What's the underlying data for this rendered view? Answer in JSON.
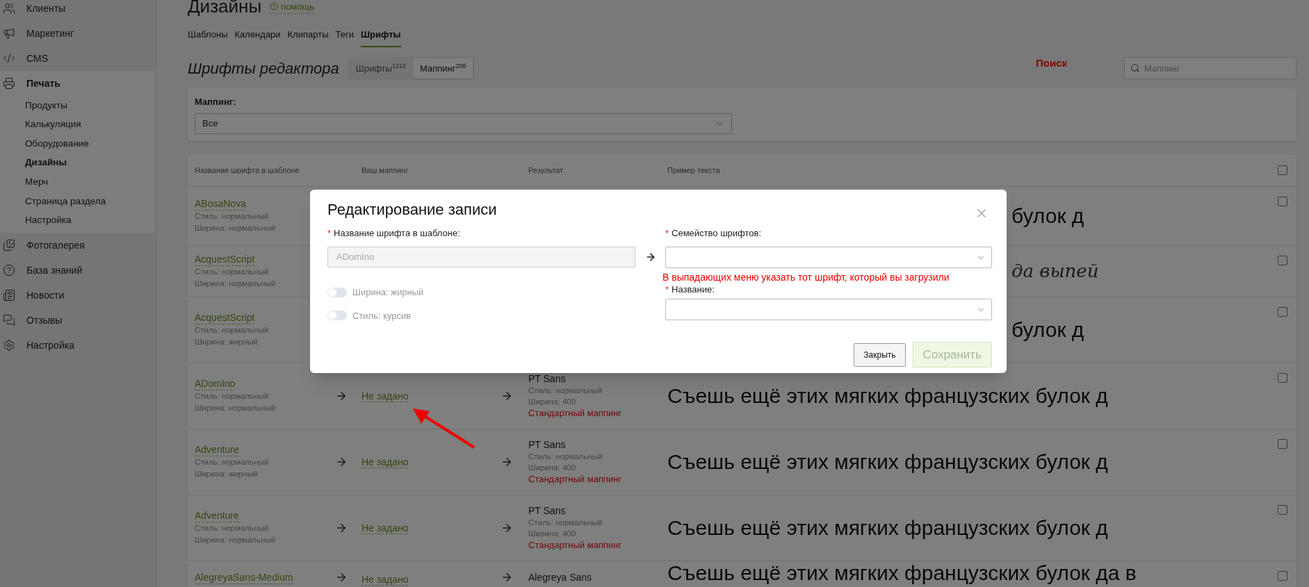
{
  "sidebar": {
    "items": [
      {
        "label": "Клиенты",
        "selected": false
      },
      {
        "label": "Маркетинг",
        "selected": false
      },
      {
        "label": "CMS",
        "selected": false
      },
      {
        "label": "Печать",
        "selected": true,
        "children": [
          {
            "label": "Продукты",
            "selected": false
          },
          {
            "label": "Калькуляция",
            "selected": false
          },
          {
            "label": "Оборудование",
            "selected": false
          },
          {
            "label": "Дизайны",
            "selected": true
          },
          {
            "label": "Мерч",
            "selected": false
          },
          {
            "label": "Страница раздела",
            "selected": false
          },
          {
            "label": "Настройка",
            "selected": false
          }
        ]
      },
      {
        "label": "Фотогалерея",
        "selected": false
      },
      {
        "label": "База знаний",
        "selected": false
      },
      {
        "label": "Новости",
        "selected": false
      },
      {
        "label": "Отзывы",
        "selected": false
      },
      {
        "label": "Настройка",
        "selected": false
      }
    ]
  },
  "page": {
    "title": "Дизайны",
    "help_link": "помощь"
  },
  "tabs": [
    {
      "label": "Шаблоны",
      "selected": false
    },
    {
      "label": "Календари",
      "selected": false
    },
    {
      "label": "Клипарты",
      "selected": false
    },
    {
      "label": "Теги",
      "selected": false
    },
    {
      "label": "Шрифты",
      "selected": true
    }
  ],
  "section": {
    "title": "Шрифты редактора",
    "switch": [
      {
        "label": "Шрифты",
        "count": "1216",
        "selected": false
      },
      {
        "label": "Маппинг",
        "count": "206",
        "selected": true
      }
    ]
  },
  "annotation_search": "Поиск",
  "search": {
    "placeholder": "Маппинг"
  },
  "filter": {
    "label": "Маппинг:",
    "value": "Все"
  },
  "table": {
    "columns": [
      "Название шрифта в шаблоне",
      "Ваш маппинг",
      "Результат",
      "Пример текста"
    ],
    "header_checked": false,
    "rows": [
      {
        "kind": "covered",
        "name": "ABosaNova",
        "style": "Стиль: нормальный",
        "width": "Ширина: нормальный",
        "sample": "булок д",
        "checked": false
      },
      {
        "kind": "covered-script",
        "name": "AcquestScript",
        "style": "Стиль: нормальный",
        "width": "Ширина: нормальный",
        "sample": "да выпей",
        "checked": false
      },
      {
        "kind": "covered",
        "name": "AcquestScript",
        "style": "Стиль: нормальный",
        "width": "Ширина: жирный",
        "sample": "булок д",
        "checked": false
      },
      {
        "kind": "full",
        "name": "ADomIno",
        "style": "Стиль: нормальный",
        "width": "Ширина: нормальный",
        "mapping": "Не задано",
        "result_font": "PT Sans",
        "result_style": "Стиль: нормальный",
        "result_width": "Ширина: 400",
        "result_note": "Стандартный маппинг",
        "sample": "Съешь ещё этих мягких французских булок д",
        "checked": false
      },
      {
        "kind": "full",
        "name": "Adventure",
        "style": "Стиль: нормальный",
        "width": "Ширина: жирный",
        "mapping": "Не задано",
        "result_font": "PT Sans",
        "result_style": "Стиль: нормальный",
        "result_width": "Ширина: 400",
        "result_note": "Стандартный маппинг",
        "sample": "Съешь ещё этих мягких французских булок д",
        "checked": false
      },
      {
        "kind": "full",
        "name": "Adventure",
        "style": "Стиль: нормальный",
        "width": "Ширина: нормальный",
        "mapping": "Не задано",
        "result_font": "PT Sans",
        "result_style": "Стиль: нормальный",
        "result_width": "Ширина: 400",
        "result_note": "Стандартный маппинг",
        "sample": "Съешь ещё этих мягких французских булок д",
        "checked": false
      },
      {
        "kind": "cut",
        "name": "AlegreyaSans-Medium",
        "mapping": "Не задано",
        "result_font": "Alegreya Sans",
        "sample": "Съешь ещё этих мягких французских булок да в",
        "checked": false
      }
    ]
  },
  "modal": {
    "title": "Редактирование записи",
    "source_field": {
      "mark": "*",
      "label": "Название шрифта в шаблоне:",
      "value": "ADomIno"
    },
    "toggles": [
      {
        "label": "Ширина: жирный",
        "on": false,
        "disabled": true
      },
      {
        "label": "Стиль: курсив",
        "on": false,
        "disabled": true
      }
    ],
    "family_field": {
      "mark": "*",
      "label": "Семейство шрифтов:"
    },
    "note": "В выпадающих меню указать тот шрифт, который вы загрузили",
    "name_field": {
      "mark": "*",
      "label": "Название:"
    },
    "buttons": [
      {
        "label": "Закрыть",
        "kind": "default",
        "disabled": false
      },
      {
        "label": "Сохранить",
        "kind": "primary",
        "disabled": true
      }
    ]
  }
}
